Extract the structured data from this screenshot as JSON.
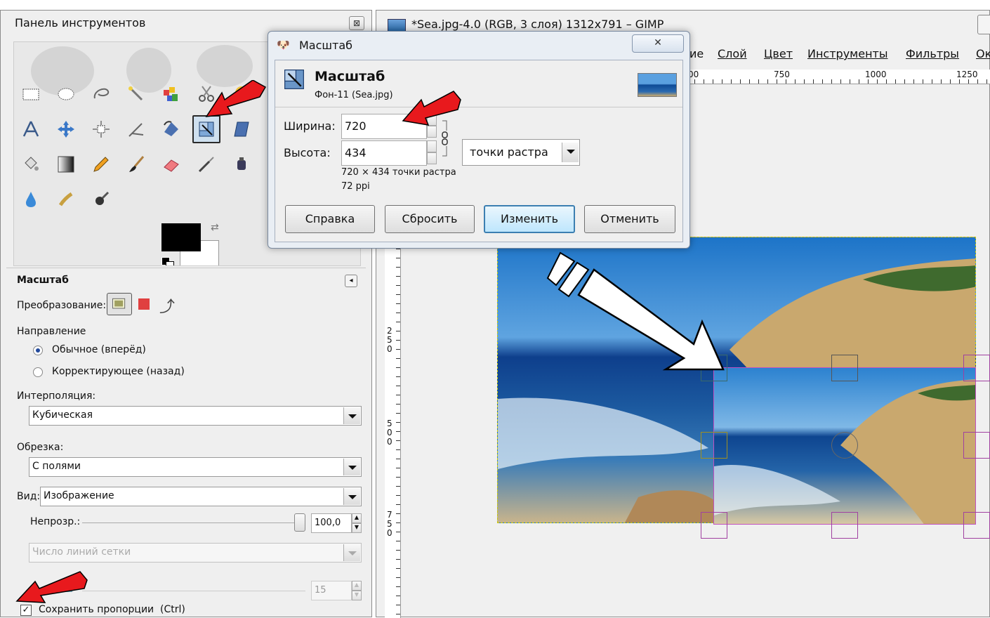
{
  "toolbox": {
    "title": "Панель инструментов",
    "close": "⊠",
    "options_title": "Масштаб",
    "transform_label": "Преобразование:",
    "direction_label": "Направление",
    "direction_normal": "Обычное (вперёд)",
    "direction_corrective": "Корректирующее (назад)",
    "interpolation_label": "Интерполяция:",
    "interpolation_value": "Кубическая",
    "clipping_label": "Обрезка:",
    "clipping_value": "С полями",
    "preview_label": "Вид:",
    "preview_value": "Изображение",
    "opacity_label": "Непрозр.:",
    "opacity_value": "100,0",
    "opacity_percent": 100,
    "grid_combo": "Число линий сетки",
    "grid_value": "15",
    "keep_aspect_label": "Сохранить пропорции",
    "keep_aspect_shortcut": "(Ctrl)",
    "keep_aspect_checked": "✓"
  },
  "image_window": {
    "title": "*Sea.jpg-4.0 (RGB, 3 слоя) 1312x791 – GIMP",
    "menu": [
      "ие",
      "Слой",
      "Цвет",
      "Инструменты",
      "Фильтры",
      "Ок"
    ],
    "ruler_top": [
      "00",
      "750",
      "1000",
      "1250"
    ],
    "ruler_left": [
      "250",
      "500",
      "750"
    ]
  },
  "dialog": {
    "window_title": "Масштаб",
    "close": "✕",
    "heading": "Масштаб",
    "subheading": "Фон-11 (Sea.jpg)",
    "width_label": "Ширина:",
    "width_value": "720",
    "height_label": "Высота:",
    "height_value": "434",
    "unit": "точки растра",
    "size_info": "720 × 434 точки растра",
    "resolution_info": "72 ppi",
    "btn_help": "Справка",
    "btn_reset": "Сбросить",
    "btn_scale": "Изменить",
    "btn_cancel": "Отменить"
  },
  "colors": {
    "annotation_red": "#e8191d",
    "active_tool": "#cfe0ef",
    "frame_magenta": "#c050c0",
    "frame_yellow": "#e0e000"
  }
}
